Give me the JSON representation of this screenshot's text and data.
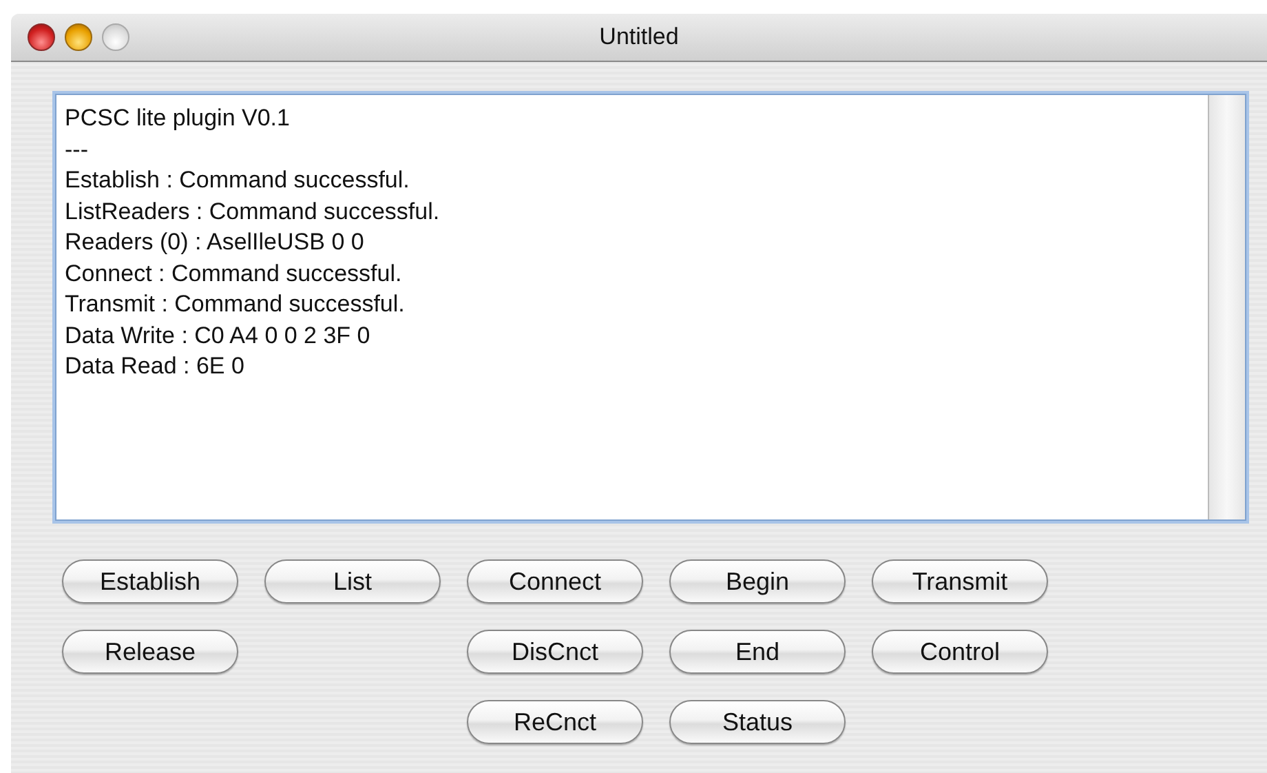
{
  "window": {
    "title": "Untitled"
  },
  "log": {
    "lines": [
      "PCSC lite plugin V0.1",
      "---",
      "Establish : Command successful.",
      "ListReaders : Command successful.",
      "Readers (0) : AselIleUSB 0 0",
      "Connect : Command successful.",
      "Transmit : Command successful.",
      "Data Write : C0 A4 0 0 2 3F 0",
      "Data Read : 6E 0"
    ]
  },
  "button_rows": [
    [
      "Establish",
      "List",
      "Connect",
      "Begin",
      "Transmit"
    ],
    [
      "Release",
      null,
      "DisCnct",
      "End",
      "Control"
    ],
    [
      null,
      null,
      "ReCnct",
      "Status",
      null
    ]
  ]
}
